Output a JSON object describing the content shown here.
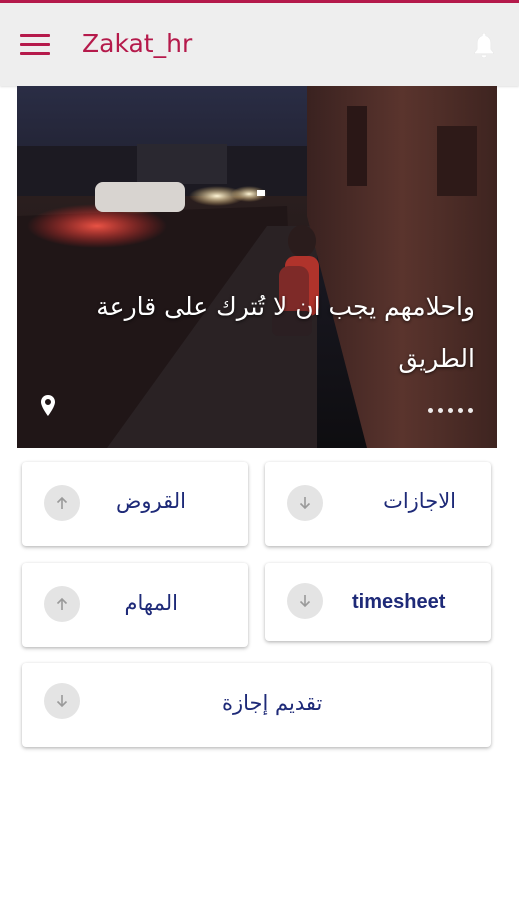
{
  "app": {
    "title": "Zakat_hr",
    "accent_color": "#b51a4b",
    "menu_icon": "hamburger-menu-icon",
    "notification_icon": "bell-icon"
  },
  "banner": {
    "caption": "واحلامهم يجب ان لا تُترك على قارعة الطريق",
    "location_icon": "location-pin-icon",
    "slide_count": 5
  },
  "actions": {
    "leaves": {
      "label": "الاجازات",
      "icon": "arrow-down-icon"
    },
    "loans": {
      "label": "القروض",
      "icon": "arrow-up-icon"
    },
    "timesheet": {
      "label": "timesheet",
      "icon": "arrow-down-icon"
    },
    "tasks": {
      "label": "المهام",
      "icon": "arrow-up-icon"
    },
    "leave_request": {
      "label": "تقديم إجازة",
      "icon": "arrow-down-icon"
    }
  }
}
